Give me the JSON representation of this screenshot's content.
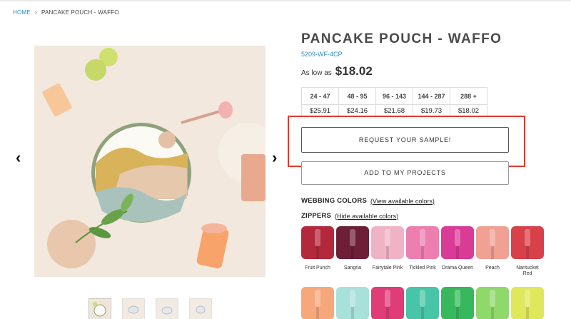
{
  "breadcrumb": {
    "home": "HOME",
    "separator": "›",
    "current": "PANCAKE POUCH - WAFFO"
  },
  "carousel": {
    "prev_icon": "‹",
    "next_icon": "›"
  },
  "product": {
    "title": "PANCAKE POUCH - WAFFO",
    "sku": "5209-WF-4CP",
    "as_low_as_label": "As low as",
    "price": "$18.02"
  },
  "pricing": {
    "headers": [
      "24 - 47",
      "48 - 95",
      "96 - 143",
      "144 - 287",
      "288 +"
    ],
    "prices": [
      "$25.91",
      "$24.16",
      "$21.68",
      "$19.73",
      "$18.02"
    ]
  },
  "buttons": {
    "sample": "REQUEST YOUR SAMPLE!",
    "projects": "ADD TO MY PROJECTS"
  },
  "webbing": {
    "label": "WEBBING COLORS",
    "link": "(View available colors)"
  },
  "zippers": {
    "label": "ZIPPERS",
    "link": "(Hide available colors)",
    "colors": [
      {
        "name": "Fruit Punch",
        "color": "#b3283b"
      },
      {
        "name": "Sangria",
        "color": "#6e1f38"
      },
      {
        "name": "Fairytale Pink",
        "color": "#f0b3c6"
      },
      {
        "name": "Tickled Pink",
        "color": "#ec7fb0"
      },
      {
        "name": "Drama Queen",
        "color": "#d93b97"
      },
      {
        "name": "Peach",
        "color": "#f1a094"
      },
      {
        "name": "Nantucket Red",
        "color": "#d8404a"
      },
      {
        "name": "",
        "color": "#f6a87c"
      },
      {
        "name": "",
        "color": "#a8e0da"
      },
      {
        "name": "",
        "color": "#e03c78"
      },
      {
        "name": "",
        "color": "#48c4a6"
      },
      {
        "name": "",
        "color": "#38b85c"
      },
      {
        "name": "",
        "color": "#8fd86a"
      },
      {
        "name": "",
        "color": "#dfe85a"
      }
    ]
  },
  "accent": {
    "link_blue": "#2e8bc0",
    "highlight_red": "#e03a2e"
  }
}
